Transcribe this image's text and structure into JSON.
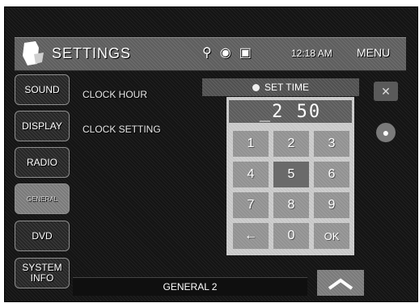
{
  "header": {
    "title": "SETTINGS",
    "time": "12:18 AM",
    "menu_label": "MENU",
    "status_icons": [
      "usb-icon",
      "disc-icon",
      "device-icon"
    ]
  },
  "sidebar": {
    "items": [
      {
        "label": "SOUND"
      },
      {
        "label": "DISPLAY"
      },
      {
        "label": "RADIO"
      },
      {
        "label": "GENERAL",
        "active": true
      },
      {
        "label": "DVD"
      },
      {
        "label": "SYSTEM INFO"
      }
    ]
  },
  "content": {
    "rows": [
      {
        "label": "CLOCK HOUR"
      },
      {
        "label": "CLOCK SETTING"
      }
    ]
  },
  "keypad": {
    "set_time_label": "SET TIME",
    "display_value": "_2 50",
    "keys": [
      "1",
      "2",
      "3",
      "4",
      "5",
      "6",
      "7",
      "8",
      "9",
      "←",
      "0",
      "OK"
    ]
  },
  "footer": {
    "page_label": "GENERAL 2"
  },
  "colors": {
    "screen_bg": "#141414",
    "header_bg": "#5e5e5e",
    "keypad_bg": "#cfcfcf",
    "key_bg": "#9a9a9a"
  }
}
